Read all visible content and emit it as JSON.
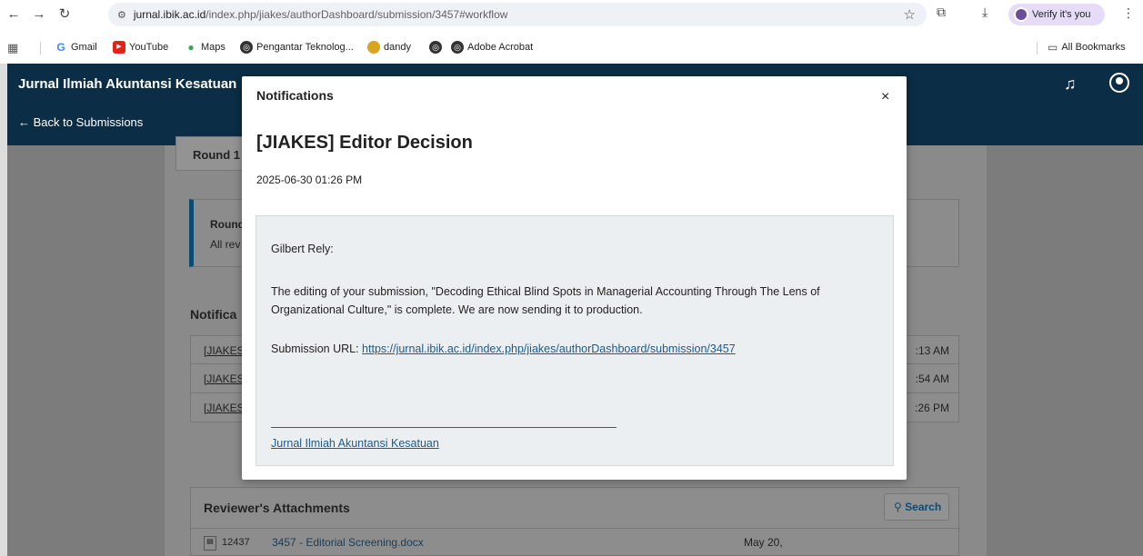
{
  "browser": {
    "url_domain": "jurnal.ibik.ac.id",
    "url_path": "/index.php/jiakes/authorDashboard/submission/3457#workflow",
    "verify_label": "Verify it's you",
    "bookmarks": [
      "Gmail",
      "YouTube",
      "Maps",
      "Pengantar Teknolog...",
      "dandy",
      "Adobe Acrobat"
    ],
    "all_bookmarks": "All Bookmarks"
  },
  "header": {
    "title": "Jurnal Ilmiah Akuntansi Kesatuan",
    "back_label": "← Back to Submissions"
  },
  "page": {
    "round_tab": "Round 1",
    "round_box_title": "Round",
    "round_box_text": "All rev",
    "notifications_heading": "Notifica",
    "rows": [
      {
        "link": "[JIAKES",
        "time": ":13 AM"
      },
      {
        "link": "[JIAKES",
        "time": ":54 AM"
      },
      {
        "link": "[JIAKES",
        "time": ":26 PM"
      }
    ],
    "attachments_title": "Reviewer's Attachments",
    "search_label": "Search",
    "attachment": {
      "id": "12437",
      "name": "3457 - Editorial Screening.docx",
      "date": "May 20,"
    }
  },
  "modal": {
    "label": "Notifications",
    "close": "×",
    "subject": "[JIAKES] Editor Decision",
    "date": "2025-06-30 01:26 PM",
    "greeting": "Gilbert Rely:",
    "paragraph": "The editing of your submission, \"Decoding Ethical Blind Spots in Managerial Accounting Through The Lens of Organizational Culture,\" is complete. We are now sending it to production.",
    "url_label": "Submission URL: ",
    "url": "https://jurnal.ibik.ac.id/index.php/jiakes/authorDashboard/submission/3457",
    "signature": "Jurnal Ilmiah Akuntansi Kesatuan"
  }
}
